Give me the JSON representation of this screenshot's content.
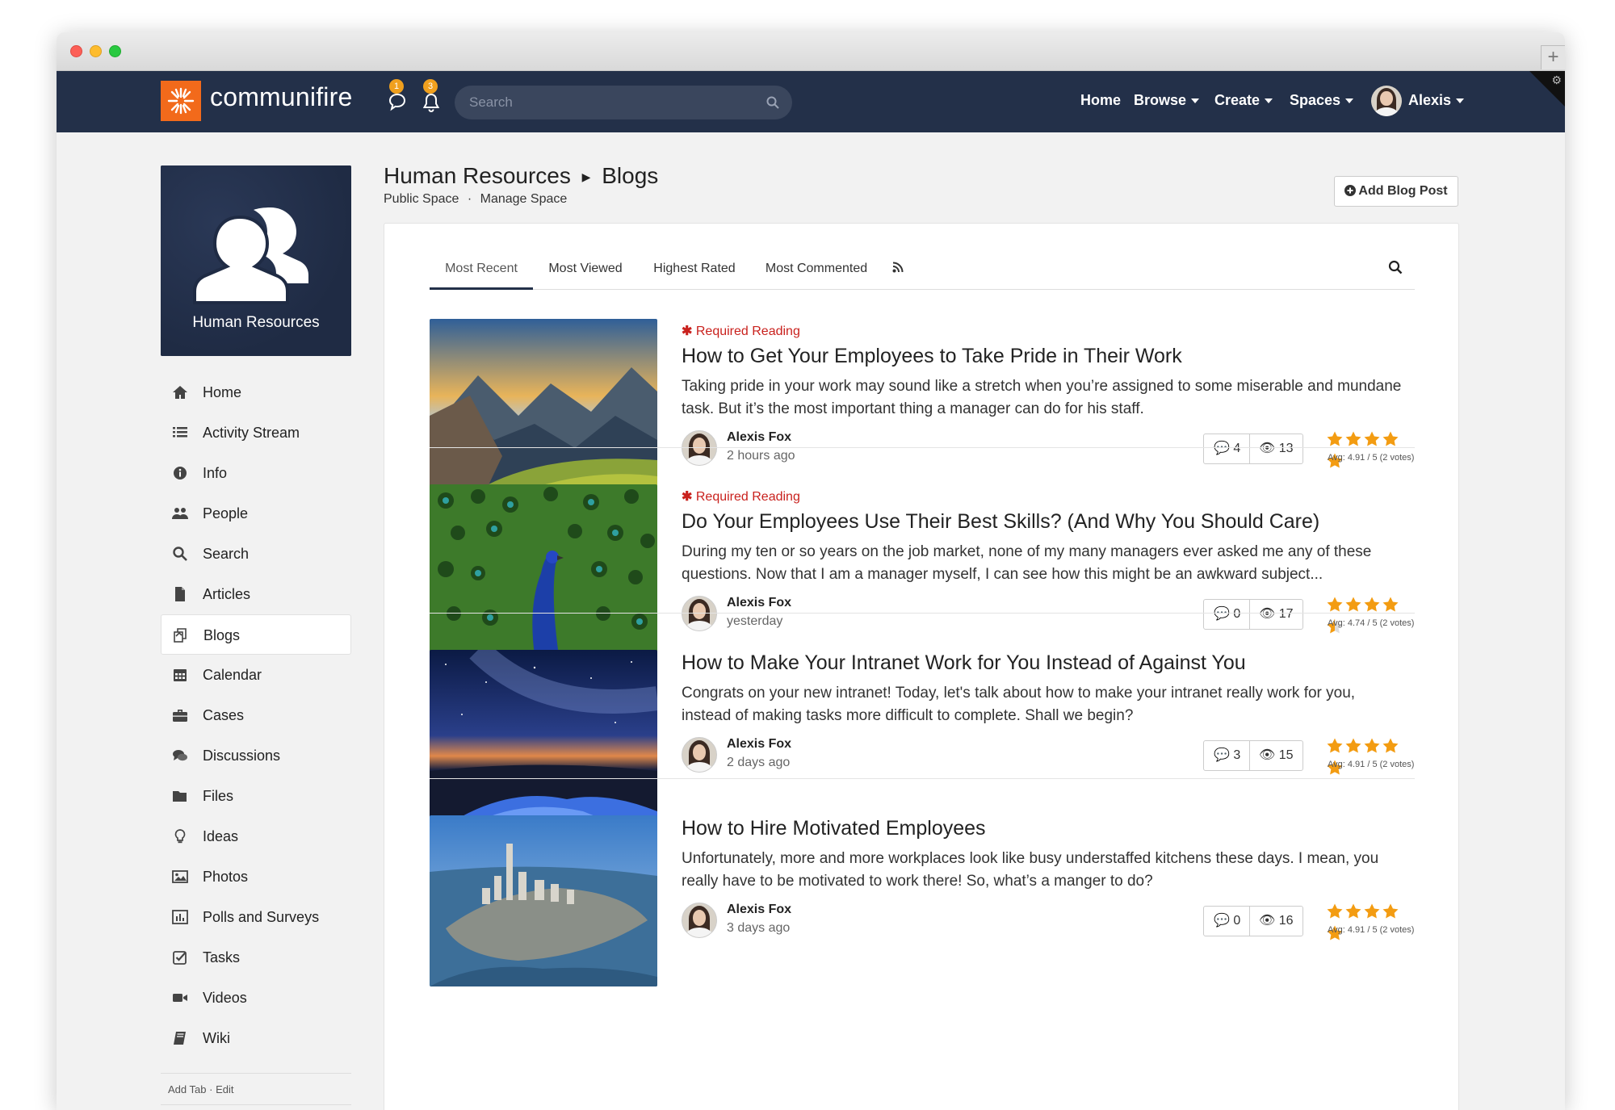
{
  "topnav": {
    "brand": "communifire",
    "messages_badge": "1",
    "notifications_badge": "3",
    "search_placeholder": "Search",
    "menu": {
      "home": "Home",
      "browse": "Browse",
      "create": "Create",
      "spaces": "Spaces",
      "user": "Alexis"
    }
  },
  "space": {
    "name": "Human Resources",
    "section": "Blogs",
    "visibility": "Public Space",
    "separator": "·",
    "manage": "Manage Space"
  },
  "sidebar": {
    "items": [
      {
        "label": "Home",
        "icon": "home-icon"
      },
      {
        "label": "Activity Stream",
        "icon": "list-icon"
      },
      {
        "label": "Info",
        "icon": "info-icon"
      },
      {
        "label": "People",
        "icon": "people-icon"
      },
      {
        "label": "Search",
        "icon": "search-icon"
      },
      {
        "label": "Articles",
        "icon": "file-icon"
      },
      {
        "label": "Blogs",
        "icon": "blogs-icon"
      },
      {
        "label": "Calendar",
        "icon": "calendar-icon"
      },
      {
        "label": "Cases",
        "icon": "briefcase-icon"
      },
      {
        "label": "Discussions",
        "icon": "comments-icon"
      },
      {
        "label": "Files",
        "icon": "folder-icon"
      },
      {
        "label": "Ideas",
        "icon": "lightbulb-icon"
      },
      {
        "label": "Photos",
        "icon": "image-icon"
      },
      {
        "label": "Polls and Surveys",
        "icon": "bar-chart-icon"
      },
      {
        "label": "Tasks",
        "icon": "checkbox-icon"
      },
      {
        "label": "Videos",
        "icon": "video-icon"
      },
      {
        "label": "Wiki",
        "icon": "book-icon"
      }
    ],
    "active": "Blogs",
    "footer_add": "Add Tab",
    "footer_sep": "·",
    "footer_edit": "Edit"
  },
  "actions": {
    "add_blog_post": "Add Blog Post"
  },
  "tabs": [
    {
      "label": "Most Recent",
      "active": true
    },
    {
      "label": "Most Viewed",
      "active": false
    },
    {
      "label": "Highest Rated",
      "active": false
    },
    {
      "label": "Most Commented",
      "active": false
    }
  ],
  "posts": [
    {
      "required": "Required Reading",
      "title": "How to Get Your Employees to Take Pride in Their Work",
      "excerpt": "Taking pride in your work may sound like a stretch when you’re assigned to some miserable and mundane task. But it’s the most important thing a manager can do for his staff.",
      "author": "Alexis Fox",
      "date": "2 hours ago",
      "comments": "4",
      "views": "13",
      "rating": 4.91,
      "avg": "Avg: 4.91 / 5 (2 votes)",
      "image": "mountain-landscape"
    },
    {
      "required": "Required Reading",
      "title": "Do Your Employees Use Their Best Skills? (And Why You Should Care)",
      "excerpt": "During my ten or so years on the job market, none of my many managers ever asked me any of these questions. Now that I am a manager myself, I can see how this might be an awkward subject...",
      "author": "Alexis Fox",
      "date": "yesterday",
      "comments": "0",
      "views": "17",
      "rating": 4.74,
      "avg": "Avg: 4.74 / 5 (2 votes)",
      "image": "peacock"
    },
    {
      "required": "",
      "title": "How to Make Your Intranet Work for You Instead of Against You",
      "excerpt": "Congrats on your new intranet! Today, let's talk about how to make your intranet really work for you, instead of making tasks more difficult to complete. Shall we begin?",
      "author": "Alexis Fox",
      "date": "2 days ago",
      "comments": "3",
      "views": "15",
      "rating": 4.91,
      "avg": "Avg: 4.91 / 5 (2 votes)",
      "image": "night-sky"
    },
    {
      "required": "",
      "title": "How to Hire Motivated Employees",
      "excerpt": "Unfortunately, more and more workplaces look like busy understaffed kitchens these days. I mean, you really have to be motivated to work there! So, what’s a manger to do?",
      "author": "Alexis Fox",
      "date": "3 days ago",
      "comments": "0",
      "views": "16",
      "rating": 4.91,
      "avg": "Avg: 4.91 / 5 (2 votes)",
      "image": "city-skyline"
    }
  ],
  "colors": {
    "nav_bg": "#233049",
    "brand_orange": "#f26a1b",
    "required_red": "#c9211d",
    "star_orange": "#f39c12",
    "badge_orange": "#f0a01e"
  }
}
